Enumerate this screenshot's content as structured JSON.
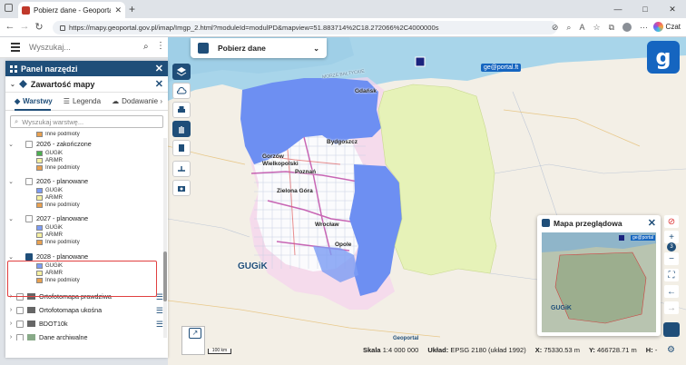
{
  "browser": {
    "tab_title": "Pobierz dane - Geoportal - GUGiK",
    "url": "https://mapy.geoportal.gov.pl/imap/Imgp_2.html?moduleId=modulPD&mapview=51.883714%2C18.272066%2C4000000s",
    "czat_label": "Czat",
    "window_controls": [
      "—",
      "□",
      "✕"
    ]
  },
  "topbar": {
    "search_placeholder": "Wyszukaj..."
  },
  "panel": {
    "title": "Panel narzędzi",
    "section_title": "Zawartość mapy",
    "tabs": [
      {
        "label": "Warstwy",
        "active": true
      },
      {
        "label": "Legenda",
        "active": false
      },
      {
        "label": "Dodawanie",
        "active": false
      }
    ],
    "layer_search_placeholder": "Wyszukaj warstwę...",
    "legend_items": [
      "GUGiK",
      "ARiMR",
      "Inne podmioty"
    ],
    "groups": [
      {
        "name": "2026 - zakończone",
        "checked": false
      },
      {
        "name": "2026 - planowane",
        "checked": false
      },
      {
        "name": "2027 - planowane",
        "checked": false
      },
      {
        "name": "2028 - planowane",
        "checked": true
      }
    ],
    "layers": [
      {
        "name": "Ortofotomapa prawdziwa"
      },
      {
        "name": "Ortofotomapa ukośna"
      },
      {
        "name": "BDOT10k"
      },
      {
        "name": "Dane archiwalne"
      }
    ],
    "inne_top": "Inne podmioty"
  },
  "download": {
    "label": "Pobierz dane"
  },
  "map": {
    "sea_label": "MORZE BAŁTYCKIE",
    "cities": [
      {
        "name": "Gdańsk"
      },
      {
        "name": "Bydgoszcz"
      },
      {
        "name": "Gorzów Wielkopolski"
      },
      {
        "name": "Poznań"
      },
      {
        "name": "Zielona Góra"
      },
      {
        "name": "Wrocław"
      },
      {
        "name": "Opole"
      }
    ],
    "watermark": "GUGiK",
    "geoportal_badge": "ge@portal.ft",
    "geoportal_footer": "Geoportal",
    "scale_bar": "100 km"
  },
  "overview": {
    "title": "Mapa przeglądowa",
    "watermark": "GUGiK",
    "badge": "ge@portal"
  },
  "zoom": {
    "level": "3"
  },
  "status": {
    "scale_label": "Skala",
    "scale_value": "1:4 000 000",
    "system_label": "Układ:",
    "system_value": "EPSG 2180 (układ 1992)",
    "x_label": "X:",
    "x_value": "75330.53 m",
    "y_label": "Y:",
    "y_value": "466728.71 m",
    "h_label": "H:",
    "h_value": "-"
  },
  "colors": {
    "primary": "#1f4e79",
    "blue_area": "#6d8ff2",
    "green_area": "#e6f2b8",
    "highlight": "#e04040"
  }
}
